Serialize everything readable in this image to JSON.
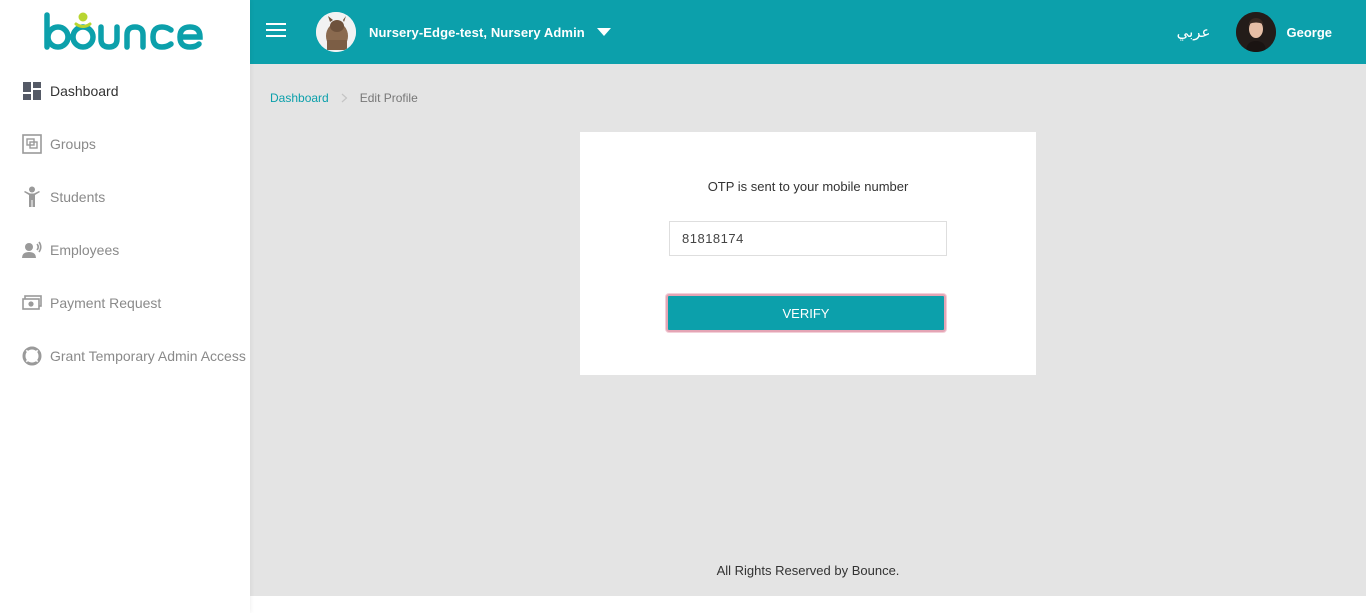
{
  "brand": {
    "logo_text": "bounce",
    "logo_color": "#0ca0ab",
    "logo_accent": "#b8d531"
  },
  "sidebar": {
    "items": [
      {
        "label": "Dashboard",
        "icon": "dashboard-icon",
        "active": true
      },
      {
        "label": "Groups",
        "icon": "groups-icon"
      },
      {
        "label": "Students",
        "icon": "student-icon"
      },
      {
        "label": "Employees",
        "icon": "employees-icon"
      },
      {
        "label": "Payment Request",
        "icon": "payment-icon"
      },
      {
        "label": "Grant Temporary Admin Access",
        "icon": "lifebuoy-icon"
      }
    ]
  },
  "topbar": {
    "nursery_label": "Nursery-Edge-test, Nursery Admin",
    "language_label": "عربي",
    "user_name": "George",
    "bg_color": "#0ca0ab"
  },
  "breadcrumb": {
    "link": "Dashboard",
    "current": "Edit Profile"
  },
  "otp_card": {
    "message": "OTP is sent to your mobile number",
    "input_value": "81818174",
    "verify_label": "VERIFY"
  },
  "footer": {
    "text": "All Rights Reserved by Bounce."
  }
}
